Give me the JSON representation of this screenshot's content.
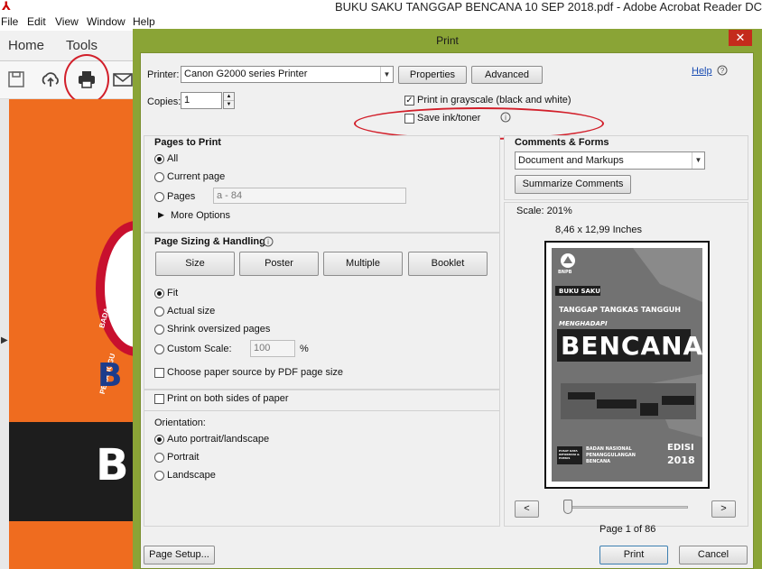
{
  "app": {
    "window_title": "BUKU SAKU TANGGAP BENCANA 10 SEP 2018.pdf - Adobe Acrobat Reader DC",
    "menu": [
      "File",
      "Edit",
      "View",
      "Window",
      "Help"
    ],
    "tabs": [
      "Home",
      "Tools"
    ],
    "doc_text": {
      "bu": "BU",
      "b": "B",
      "seal_top": "BADA",
      "seal_bottom": "PENANGGU"
    }
  },
  "dialog": {
    "title": "Print",
    "close_glyph": "✕",
    "printer_label": "Printer:",
    "printer_value": "Canon G2000 series Printer",
    "properties_label": "Properties",
    "advanced_label": "Advanced",
    "help_label": "Help",
    "copies_label": "Copies:",
    "copies_value": "1",
    "grayscale_label": "Print in grayscale (black and white)",
    "grayscale_checked": true,
    "save_ink_label": "Save ink/toner",
    "save_ink_checked": false,
    "pages_to_print": {
      "heading": "Pages to Print",
      "all": "All",
      "current_page": "Current page",
      "pages": "Pages",
      "pages_value": "a - 84",
      "more_options": "More Options",
      "selected": "All"
    },
    "sizing": {
      "heading": "Page Sizing & Handling",
      "buttons": [
        "Size",
        "Poster",
        "Multiple",
        "Booklet"
      ],
      "fit": "Fit",
      "actual_size": "Actual size",
      "shrink": "Shrink oversized pages",
      "custom_scale": "Custom Scale:",
      "custom_scale_value": "100",
      "percent": "%",
      "paper_source": "Choose paper source by PDF page size",
      "selected": "Fit"
    },
    "duplex_label": "Print on both sides of paper",
    "orientation": {
      "heading": "Orientation:",
      "auto": "Auto portrait/landscape",
      "portrait": "Portrait",
      "landscape": "Landscape",
      "selected": "Auto portrait/landscape"
    },
    "comments": {
      "heading": "Comments & Forms",
      "value": "Document and Markups",
      "summarize_label": "Summarize Comments"
    },
    "preview": {
      "scale": "Scale: 201%",
      "dimensions": "8,46 x 12,99 Inches",
      "page_info": "Page 1 of 86",
      "prev": "<",
      "next": ">",
      "slider_fraction": 0.02,
      "cover": {
        "org": "BNPB",
        "buku_saku": "BUKU SAKU",
        "tanggap": "TANGGAP TANGKAS TANGGUH",
        "menghadapi": "MENGHADAPI",
        "bencana": "BENCANA",
        "badan1": "BADAN NASIONAL",
        "badan2": "PENANGGULANGAN",
        "badan3": "BENCANA",
        "edisi": "EDISI",
        "year": "2018",
        "pusat": "PUSAT DATA INFORMASI & HUMAS"
      }
    },
    "page_setup_label": "Page Setup...",
    "print_label": "Print",
    "cancel_label": "Cancel"
  },
  "colors": {
    "dialog_frame": "#8aa436",
    "doc_orange": "#ef6c1f",
    "highlight_red": "#d21f2a",
    "close_red": "#c42b1c"
  }
}
